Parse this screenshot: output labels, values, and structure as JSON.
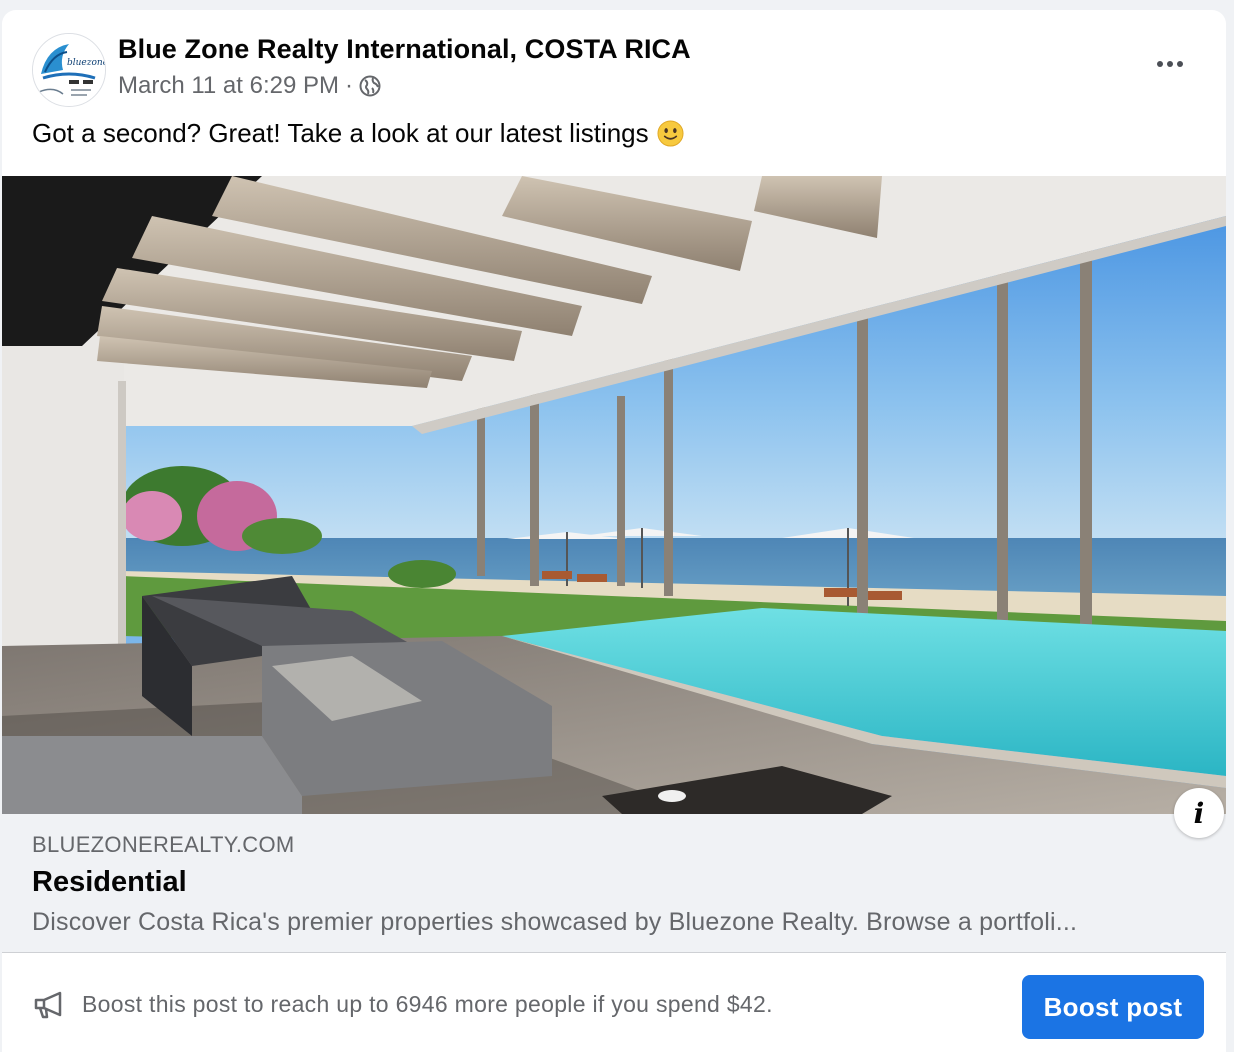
{
  "post": {
    "page_name": "Blue Zone Realty International, COSTA RICA",
    "timestamp": "March 11 at 6:29 PM",
    "separator": "·",
    "privacy_icon": "globe-icon",
    "more_icon": "more-options-icon",
    "caption": "Got a second? Great! Take a look at our latest listings",
    "caption_emoji": "slightly-smiling-face-emoji",
    "avatar_logo_text": "bluezone"
  },
  "link_preview": {
    "domain": "BLUEZONEREALTY.COM",
    "title": "Residential",
    "description": "Discover Costa Rica's premier properties showcased by Bluezone Realty. Browse a portfoli...",
    "info_label": "i"
  },
  "boost": {
    "icon": "megaphone-icon",
    "text": "Boost this post to reach up to 6946 more people if you spend $42.",
    "button_label": "Boost post"
  },
  "colors": {
    "boost_button": "#1b74e4",
    "text_primary": "#050505",
    "text_secondary": "#65676b",
    "preview_background": "#f0f2f5"
  }
}
